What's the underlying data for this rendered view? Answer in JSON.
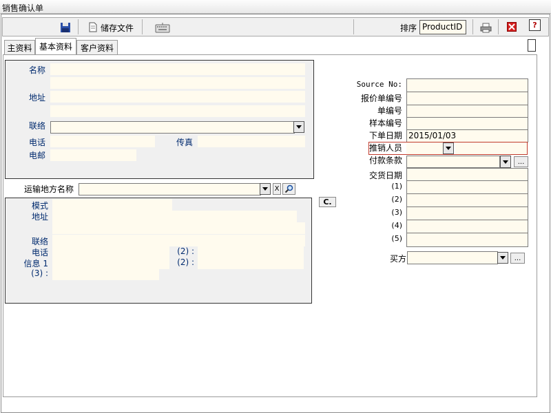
{
  "window": {
    "title": "销售确认单"
  },
  "toolbar": {
    "save_label": "储存文件",
    "sort_label": "排序",
    "sort_value": "ProductID"
  },
  "tabs": [
    "主资料",
    "基本资料",
    "客户资料"
  ],
  "basic": {
    "name_label": "名称",
    "address_label": "地址",
    "contact_label": "联络",
    "phone_label": "电话",
    "fax_label": "传真",
    "email_label": "电邮"
  },
  "shipping": {
    "place_label": "运输地方名称",
    "clear_btn": "X",
    "mode_label": "模式",
    "address_label": "地址",
    "contact_label": "联络",
    "phone_label": "电话",
    "phone2_label": "(2) :",
    "info1_label": "信息 1",
    "info2_label": "(2) :",
    "info3_label": "(3) :"
  },
  "copy_button": "C.",
  "right": {
    "source_no_label": "Source No:",
    "quote_no_label": "报价单编号",
    "doc_no_label": "单编号",
    "sample_no_label": "样本编号",
    "order_date_label": "下单日期",
    "order_date_value": "2015/01/03",
    "sales_label": "推销人员",
    "payment_label": "付款条款",
    "delivery_label": "交货日期",
    "extra": [
      "(1)",
      "(2)",
      "(3)",
      "(4)",
      "(5)"
    ],
    "buyer_label": "买方",
    "ellipsis": "..."
  }
}
